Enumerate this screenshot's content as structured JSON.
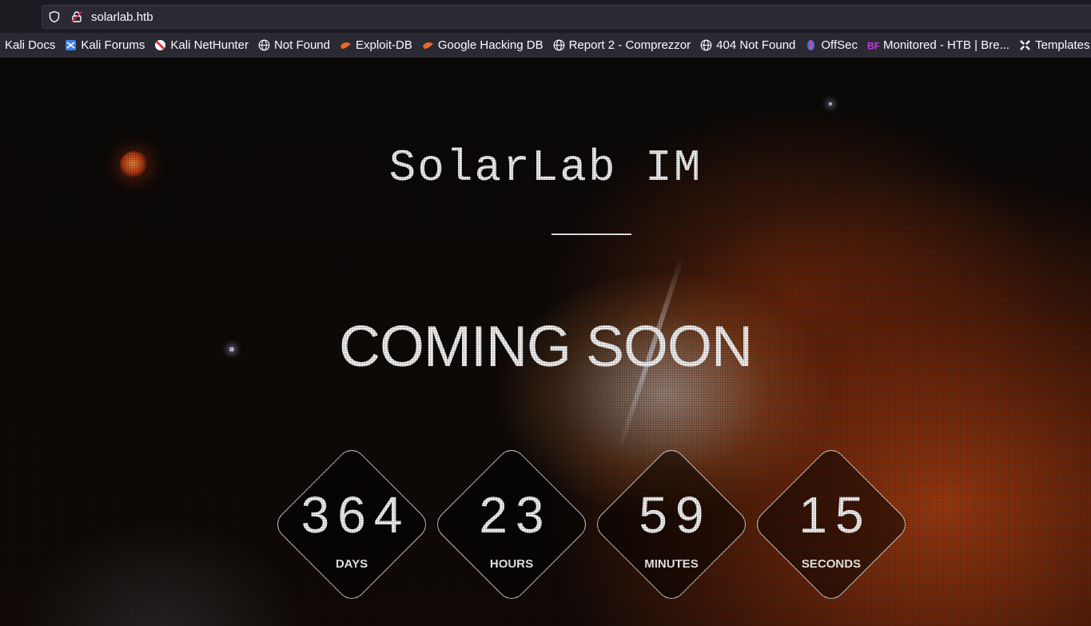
{
  "browser": {
    "url": "solarlab.htb",
    "bookmarks": [
      {
        "label": "Kali Docs",
        "icon": "kali-docs-icon",
        "color": ""
      },
      {
        "label": "Kali Forums",
        "icon": "kali-forums-icon",
        "color": "#3d7fe8"
      },
      {
        "label": "Kali NetHunter",
        "icon": "kali-nethunter-icon",
        "color": "#d63a3a"
      },
      {
        "label": "Not Found",
        "icon": "globe-icon",
        "color": "#fbfbfe"
      },
      {
        "label": "Exploit-DB",
        "icon": "exploit-db-icon",
        "color": "#e8682a"
      },
      {
        "label": "Google Hacking DB",
        "icon": "ghdb-icon",
        "color": "#e8682a"
      },
      {
        "label": "Report 2 - Comprezzor",
        "icon": "globe-icon",
        "color": "#fbfbfe"
      },
      {
        "label": "404 Not Found",
        "icon": "globe-icon",
        "color": "#fbfbfe"
      },
      {
        "label": "OffSec",
        "icon": "offsec-icon",
        "color": "#4a6cf0"
      },
      {
        "label": "Monitored - HTB | Bre...",
        "icon": "breachforums-icon",
        "color": "#c23ce6"
      },
      {
        "label": "Templates: C",
        "icon": "joomla-icon",
        "color": "#fbfbfe"
      }
    ]
  },
  "page": {
    "title": "SolarLab IM",
    "headline": "COMING SOON",
    "countdown": [
      {
        "value": "364",
        "label": "DAYS"
      },
      {
        "value": "23",
        "label": "HOURS"
      },
      {
        "value": "59",
        "label": "MINUTES"
      },
      {
        "value": "15",
        "label": "SECONDS"
      }
    ]
  }
}
